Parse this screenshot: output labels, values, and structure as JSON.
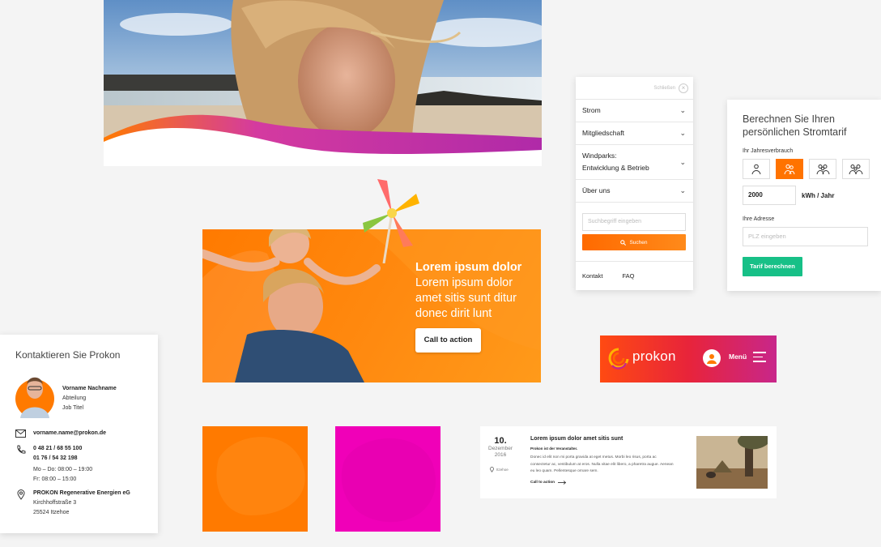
{
  "colors": {
    "orange": "#ff7a00",
    "magenta": "#f000b8",
    "green": "#17c087",
    "red": "#e8243a"
  },
  "banner": {
    "headline_bold": "Lorem ipsum dolor",
    "headline_rest": "Lorem ipsum dolor amet sitis sunt ditur donec dirit lunt",
    "cta": "Call to action"
  },
  "menu": {
    "close_label": "Schließen",
    "items": [
      {
        "label": "Strom"
      },
      {
        "label": "Mitgliedschaft"
      },
      {
        "label_line1": "Windparks:",
        "label_line2": "Entwicklung & Betrieb"
      },
      {
        "label": "Über uns"
      }
    ],
    "search_placeholder": "Suchbegriff eingeben",
    "search_button": "Suchen",
    "footer": [
      "Kontakt",
      "FAQ"
    ]
  },
  "tariff": {
    "title": "Berechnen Sie Ihren persönlichen Stromtarif",
    "consumption_label": "Ihr Jahresverbrauch",
    "persons_selected": 2,
    "kwh_value": "2000",
    "kwh_unit": "kWh / Jahr",
    "address_label": "Ihre Adresse",
    "plz_placeholder": "PLZ eingeben",
    "button": "Tarif berechnen"
  },
  "header": {
    "logo": "prokon",
    "menu_label": "Menü"
  },
  "contact": {
    "title": "Kontaktieren Sie Prokon",
    "name": "Vorname Nachname",
    "department": "Abteilung",
    "job": "Job Titel",
    "email": "vorname.name@prokon.de",
    "phone1": "0 48 21 / 68 55 100",
    "phone2": "01 76 / 54 32 198",
    "hours1": "Mo – Do: 08:00 – 19:00",
    "hours2": "Fr: 08:00 – 15:00",
    "company": "PROKON Regenerative Energien eG",
    "street": "Kirchhoffstraße 3",
    "city": "25524 Itzehoe"
  },
  "event": {
    "day": "10.",
    "month": "Dezember",
    "year": "2016",
    "location": "Itzehoe",
    "title": "Lorem ipsum dolor amet sitis sunt",
    "subtitle": "Prokon ist der Veranstalter.",
    "body": "Donec id elit non mi porta gravida at eget metus. Morbi leo risus, porta ac consectetur ac, vestibulum at eros. Nulla vitae elit libero, a pharetra augue. Aenean eu leo quam. Pellentesque ornare sem.",
    "cta": "Call to action"
  }
}
